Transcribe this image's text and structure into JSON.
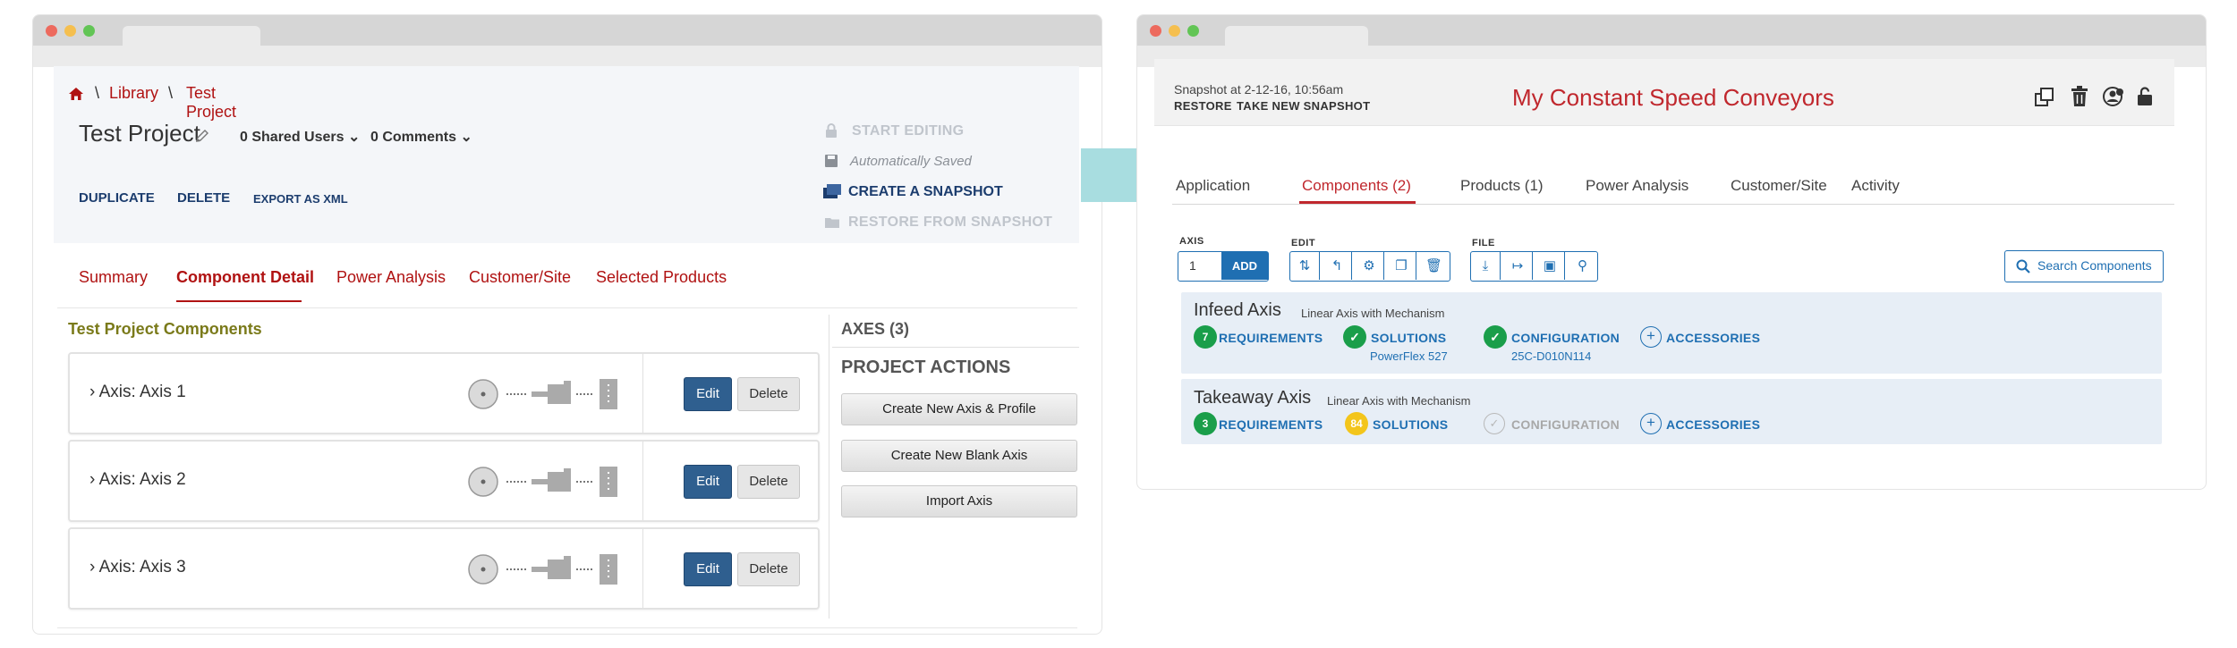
{
  "left": {
    "breadcrumb": [
      "Library",
      "Test Project"
    ],
    "project_title": "Test Project",
    "shared_users": "0 Shared Users",
    "comments": "0 Comments",
    "actions": {
      "duplicate": "DUPLICATE",
      "delete": "DELETE",
      "export": "EXPORT AS XML"
    },
    "side_actions": {
      "start_editing": "START EDITING",
      "auto_saved": "Automatically Saved",
      "create_snapshot": "CREATE A SNAPSHOT",
      "restore_snapshot": "RESTORE FROM SNAPSHOT"
    },
    "tabs": [
      "Summary",
      "Component Detail",
      "Power Analysis",
      "Customer/Site",
      "Selected Products"
    ],
    "components_heading": "Test Project Components",
    "axes": [
      {
        "label": "Axis: Axis 1"
      },
      {
        "label": "Axis: Axis 2"
      },
      {
        "label": "Axis: Axis 3"
      }
    ],
    "edit_label": "Edit",
    "delete_label": "Delete",
    "axes_count_label": "AXES (3)",
    "project_actions_title": "PROJECT ACTIONS",
    "project_actions": [
      "Create New Axis & Profile",
      "Create New Blank Axis",
      "Import Axis"
    ]
  },
  "right": {
    "snapshot_at": "Snapshot at 2-12-16, 10:56am",
    "restore": "RESTORE",
    "take_new_snapshot": "TAKE NEW SNAPSHOT",
    "title": "My Constant Speed Conveyors",
    "tabs": [
      "Application",
      "Components (2)",
      "Products (1)",
      "Power Analysis",
      "Customer/Site",
      "Activity"
    ],
    "toolbar": {
      "axis_label": "AXIS",
      "axis_value": "1",
      "add_label": "ADD",
      "edit_label": "EDIT",
      "file_label": "FILE"
    },
    "search_label": "Search Components",
    "components": [
      {
        "name": "Infeed Axis",
        "type": "Linear Axis with Mechanism",
        "requirements_count": "7",
        "requirements": "REQUIREMENTS",
        "solutions": "SOLUTIONS",
        "solutions_value": "PowerFlex 527",
        "configuration": "CONFIGURATION",
        "configuration_value": "25C-D010N114",
        "accessories": "ACCESSORIES"
      },
      {
        "name": "Takeaway Axis",
        "type": "Linear Axis with Mechanism",
        "requirements_count": "3",
        "requirements": "REQUIREMENTS",
        "solutions_count": "84",
        "solutions": "SOLUTIONS",
        "configuration": "CONFIGURATION",
        "accessories": "ACCESSORIES"
      }
    ]
  },
  "colors": {
    "brand_red": "#b01212",
    "accent_blue": "#1f6fb2",
    "edit_blue": "#2f5f8f",
    "success_green": "#1a9e4a",
    "warning_yellow": "#f3c51b",
    "arrow_teal": "#a8dde0"
  }
}
